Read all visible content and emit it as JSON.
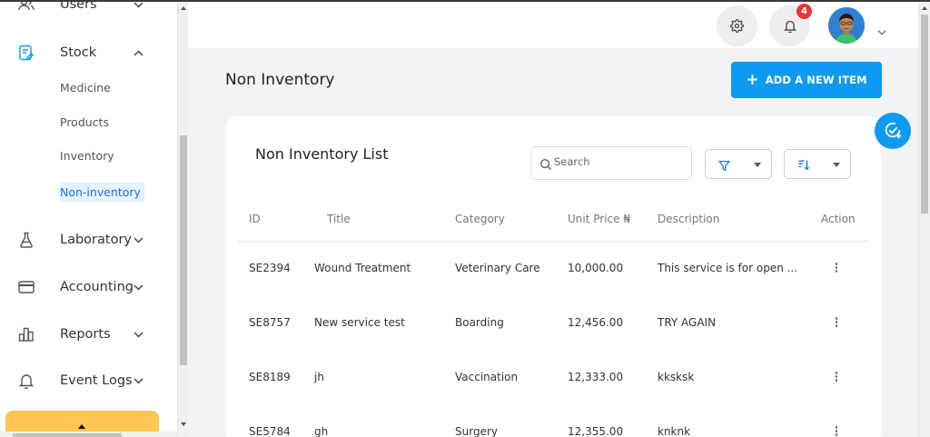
{
  "sidebar": {
    "items": [
      {
        "label": "Users",
        "icon": "users-icon"
      },
      {
        "label": "Stock",
        "icon": "stock-icon"
      },
      {
        "label": "Laboratory",
        "icon": "flask-icon"
      },
      {
        "label": "Accounting",
        "icon": "card-icon"
      },
      {
        "label": "Reports",
        "icon": "bar-chart-icon"
      },
      {
        "label": "Event Logs",
        "icon": "bell-icon"
      }
    ],
    "stock_sub": [
      "Medicine",
      "Products",
      "Inventory",
      "Non-inventory"
    ],
    "active_sub": "Non-inventory"
  },
  "header": {
    "notification_count": "4"
  },
  "page": {
    "title": "Non Inventory",
    "add_button": "ADD A NEW ITEM"
  },
  "list": {
    "title": "Non Inventory List",
    "search_placeholder": "Search",
    "columns": [
      "ID",
      "Title",
      "Category",
      "Unit Price ₦",
      "Description",
      "Action"
    ],
    "rows": [
      {
        "id": "SE2394",
        "title": "Wound Treatment",
        "category": "Veterinary Care",
        "price": "10,000.00",
        "description": "This service is for open ..."
      },
      {
        "id": "SE8757",
        "title": "New service test",
        "category": "Boarding",
        "price": "12,456.00",
        "description": "TRY AGAIN"
      },
      {
        "id": "SE8189",
        "title": "jh",
        "category": "Vaccination",
        "price": "12,333.00",
        "description": "kksksk"
      },
      {
        "id": "SE5784",
        "title": "gh",
        "category": "Surgery",
        "price": "12,355.00",
        "description": "knknk"
      }
    ]
  },
  "colors": {
    "accent": "#0d9af0",
    "active_link": "#1a73e8",
    "badge": "#e53935",
    "sidebar_footer": "#fdc654"
  }
}
